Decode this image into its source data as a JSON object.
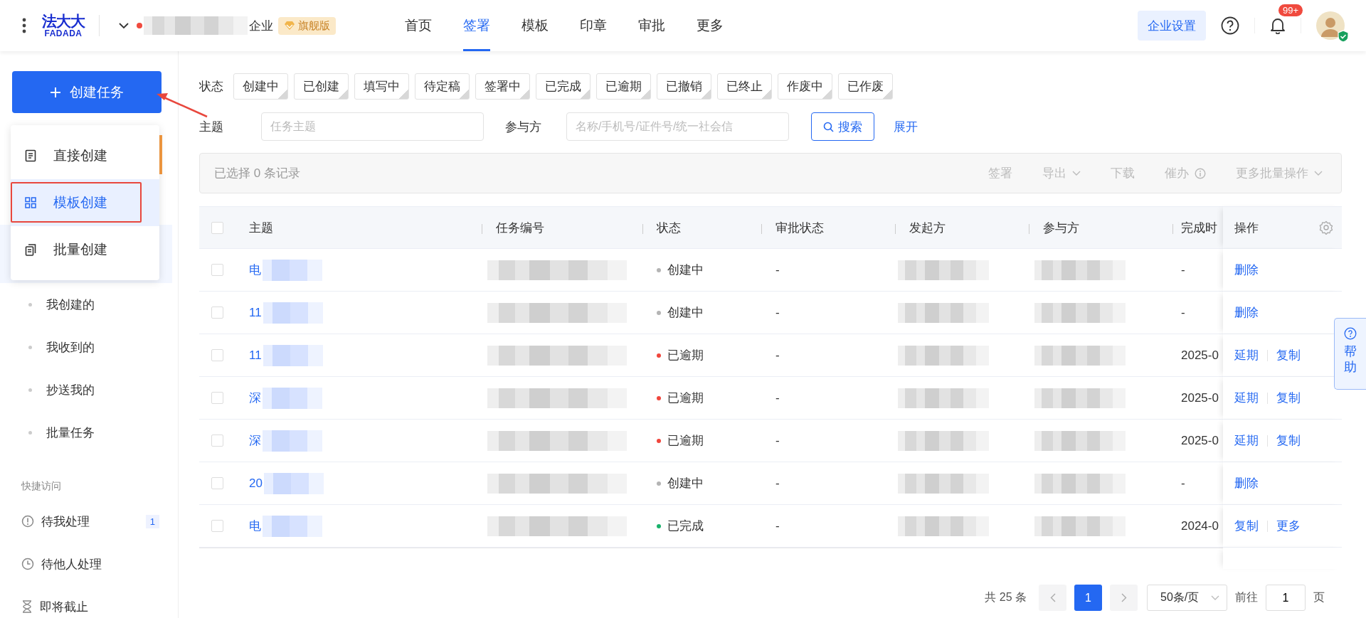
{
  "header": {
    "logo": {
      "cn": "法大大",
      "en": "FADADA"
    },
    "company_suffix": "企业",
    "edition_badge": "旗舰版",
    "nav": [
      {
        "label": "首页",
        "selected": false
      },
      {
        "label": "签署",
        "selected": true
      },
      {
        "label": "模板",
        "selected": false
      },
      {
        "label": "印章",
        "selected": false
      },
      {
        "label": "审批",
        "selected": false
      },
      {
        "label": "更多",
        "selected": false
      }
    ],
    "settings_button": "企业设置",
    "notification_count": "99+"
  },
  "sidebar": {
    "create_button": "创建任务",
    "create_menu": [
      {
        "label": "直接创建",
        "selected": false,
        "kind": "doc"
      },
      {
        "label": "模板创建",
        "selected": true,
        "kind": "grid"
      },
      {
        "label": "批量创建",
        "selected": false,
        "kind": "copy"
      }
    ],
    "items": [
      {
        "label": "我创建的"
      },
      {
        "label": "我收到的"
      },
      {
        "label": "抄送我的"
      },
      {
        "label": "批量任务"
      }
    ],
    "quick_access_title": "快捷访问",
    "quick_access": [
      {
        "label": "待我处理",
        "count": "1",
        "kind": "alert"
      },
      {
        "label": "待他人处理",
        "kind": "clock"
      },
      {
        "label": "即将截止",
        "kind": "hourglass"
      }
    ]
  },
  "filters": {
    "status_label": "状态",
    "statuses": [
      {
        "label": "创建中",
        "selected": false
      },
      {
        "label": "已创建",
        "selected": false
      },
      {
        "label": "填写中",
        "selected": false
      },
      {
        "label": "待定稿",
        "selected": false
      },
      {
        "label": "签署中",
        "selected": false
      },
      {
        "label": "已完成",
        "selected": false
      },
      {
        "label": "已逾期",
        "selected": false
      },
      {
        "label": "已撤销",
        "selected": false
      },
      {
        "label": "已终止",
        "selected": false
      },
      {
        "label": "作废中",
        "selected": false
      },
      {
        "label": "已作废",
        "selected": false
      }
    ],
    "subject_label": "主题",
    "subject_placeholder": "任务主题",
    "participant_label": "参与方",
    "participant_placeholder": "名称/手机号/证件号/统一社会信",
    "search_button": "搜索",
    "expand_link": "展开"
  },
  "toolbar": {
    "selection_text": "已选择 0 条记录",
    "actions": [
      {
        "label": "签署",
        "kind": "plain",
        "disabled": true
      },
      {
        "label": "导出",
        "kind": "dropdown",
        "disabled": true
      },
      {
        "label": "下载",
        "kind": "plain",
        "disabled": true
      },
      {
        "label": "催办",
        "kind": "info",
        "disabled": true
      },
      {
        "label": "更多批量操作",
        "kind": "dropdown",
        "disabled": true
      }
    ]
  },
  "table": {
    "select_all_checked": false,
    "columns": [
      "主题",
      "任务编号",
      "状态",
      "审批状态",
      "发起方",
      "参与方",
      "完成时",
      "操作"
    ],
    "rows": [
      {
        "checked": false,
        "subject": "电",
        "status": "创建中",
        "color": "#b4b4b4",
        "approval": "-",
        "completed": "-",
        "actions": [
          "删除"
        ]
      },
      {
        "checked": false,
        "subject": "11",
        "status": "创建中",
        "color": "#b4b4b4",
        "approval": "-",
        "completed": "-",
        "actions": [
          "删除"
        ]
      },
      {
        "checked": false,
        "subject": "11",
        "status": "已逾期",
        "color": "#f0463c",
        "approval": "-",
        "completed": "2025-0",
        "actions": [
          "延期",
          "复制"
        ]
      },
      {
        "checked": false,
        "subject": "深",
        "status": "已逾期",
        "color": "#f0463c",
        "approval": "-",
        "completed": "2025-0",
        "actions": [
          "延期",
          "复制"
        ]
      },
      {
        "checked": false,
        "subject": "深",
        "status": "已逾期",
        "color": "#f0463c",
        "approval": "-",
        "completed": "2025-0",
        "actions": [
          "延期",
          "复制"
        ]
      },
      {
        "checked": false,
        "subject": "20",
        "status": "创建中",
        "color": "#b4b4b4",
        "approval": "-",
        "completed": "-",
        "actions": [
          "删除"
        ]
      },
      {
        "checked": false,
        "subject": "电",
        "status": "已完成",
        "color": "#19b26b",
        "approval": "-",
        "completed": "2024-0",
        "actions": [
          "复制",
          "更多"
        ]
      }
    ]
  },
  "pagination": {
    "total": "共 25 条",
    "page": "1",
    "page_size": "50条/页",
    "goto_label": "前往",
    "goto_value": "1",
    "page_suffix": "页"
  },
  "help_tab": "帮助"
}
